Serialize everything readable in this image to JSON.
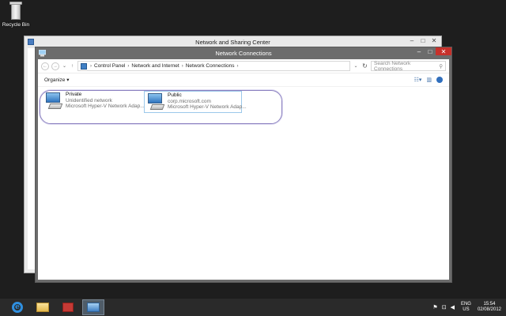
{
  "desktop": {
    "recycle_bin_label": "Recycle Bin"
  },
  "back_window": {
    "title": "Network and Sharing Center"
  },
  "window": {
    "title": "Network Connections",
    "address": {
      "crumbs": [
        "Control Panel",
        "Network and Internet",
        "Network Connections"
      ],
      "search_placeholder": "Search Network Connections"
    },
    "command_bar": {
      "organize_label": "Organize"
    },
    "connections": [
      {
        "name": "Private",
        "status": "Unidentified network",
        "adapter": "Microsoft Hyper-V Network Adap..."
      },
      {
        "name": "Public",
        "status": "corp.microsoft.com",
        "adapter": "Microsoft Hyper-V Network Adap..."
      }
    ]
  },
  "taskbar": {
    "language": {
      "line1": "ENG",
      "line2": "US"
    },
    "clock": {
      "time": "15:54",
      "date": "02/08/2012"
    }
  },
  "colors": {
    "accent": "#2f6fbf",
    "highlight_ring": "#8a7fbf",
    "close_button": "#c7312b"
  }
}
